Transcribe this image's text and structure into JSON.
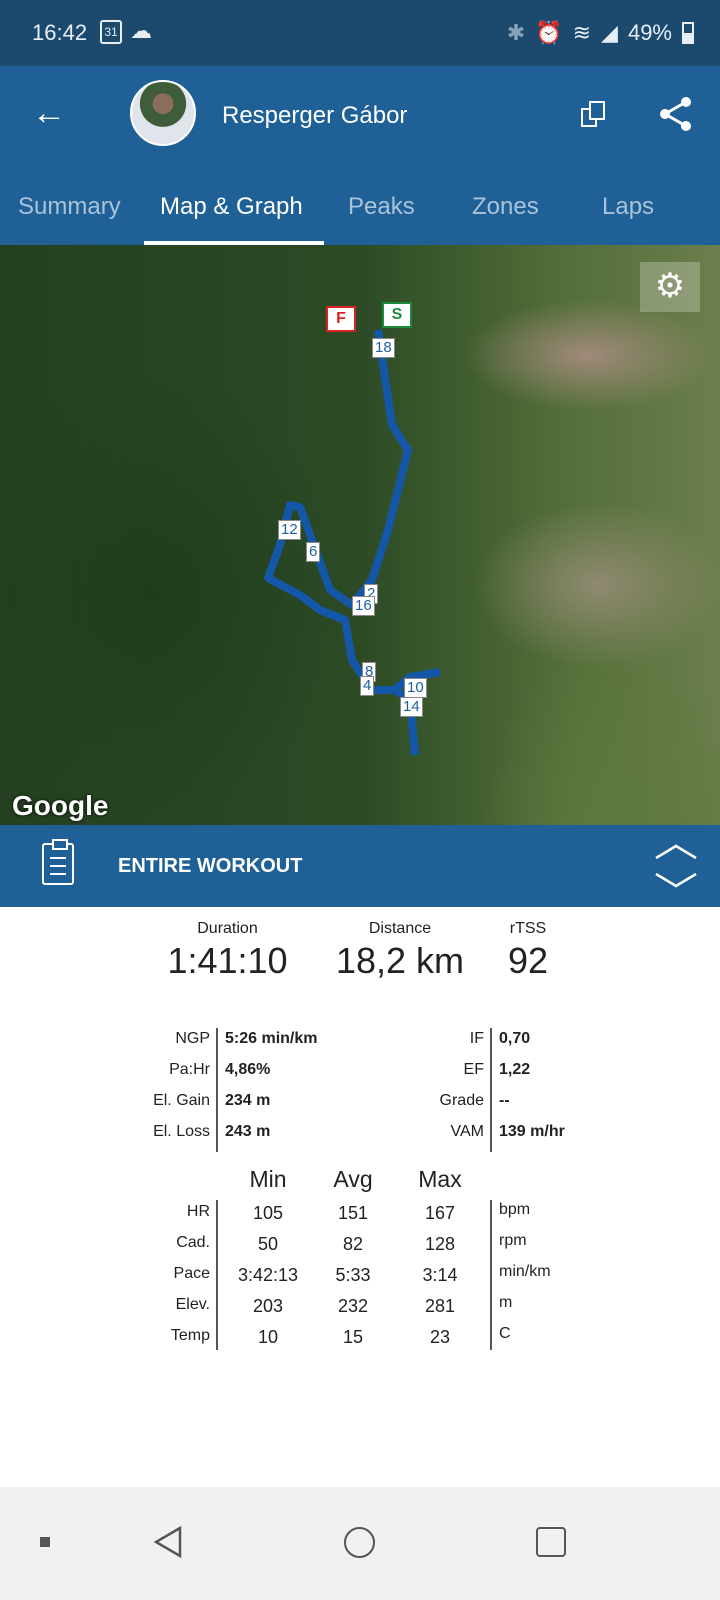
{
  "status": {
    "time": "16:42",
    "calendar": "31",
    "battery": "49%",
    "icons": [
      "cloud-icon",
      "bluetooth-icon",
      "alarm-icon",
      "wifi-icon",
      "signal-icon",
      "battery-icon"
    ]
  },
  "header": {
    "user_name": "Resperger Gábor"
  },
  "tabs": [
    {
      "label": "Summary"
    },
    {
      "label": "Map & Graph",
      "active": true
    },
    {
      "label": "Peaks"
    },
    {
      "label": "Zones"
    },
    {
      "label": "Laps"
    }
  ],
  "map": {
    "finish": "F",
    "start": "S",
    "markers": [
      "18",
      "12",
      "6",
      "2",
      "16",
      "8",
      "4",
      "10",
      "14"
    ],
    "attribution": "Google",
    "route_color": "#1457a8"
  },
  "section": {
    "title": "ENTIRE WORKOUT"
  },
  "summary": [
    {
      "label": "Duration",
      "value": "1:41:10"
    },
    {
      "label": "Distance",
      "value": "18,2 km"
    },
    {
      "label": "rTSS",
      "value": "92"
    }
  ],
  "metrics_left": [
    {
      "k": "NGP",
      "v": "5:26 min/km"
    },
    {
      "k": "Pa:Hr",
      "v": "4,86%"
    },
    {
      "k": "El. Gain",
      "v": "234 m"
    },
    {
      "k": "El. Loss",
      "v": "243 m"
    }
  ],
  "metrics_right": [
    {
      "k": "IF",
      "v": "0,70"
    },
    {
      "k": "EF",
      "v": "1,22"
    },
    {
      "k": "Grade",
      "v": "--"
    },
    {
      "k": "VAM",
      "v": "139 m/hr"
    }
  ],
  "table": {
    "headers": [
      "Min",
      "Avg",
      "Max"
    ],
    "rows": [
      {
        "k": "HR",
        "min": "105",
        "avg": "151",
        "max": "167",
        "unit": "bpm"
      },
      {
        "k": "Cad.",
        "min": "50",
        "avg": "82",
        "max": "128",
        "unit": "rpm"
      },
      {
        "k": "Pace",
        "min": "3:42:13",
        "avg": "5:33",
        "max": "3:14",
        "unit": "min/km"
      },
      {
        "k": "Elev.",
        "min": "203",
        "avg": "232",
        "max": "281",
        "unit": "m"
      },
      {
        "k": "Temp",
        "min": "10",
        "avg": "15",
        "max": "23",
        "unit": "C"
      }
    ]
  }
}
